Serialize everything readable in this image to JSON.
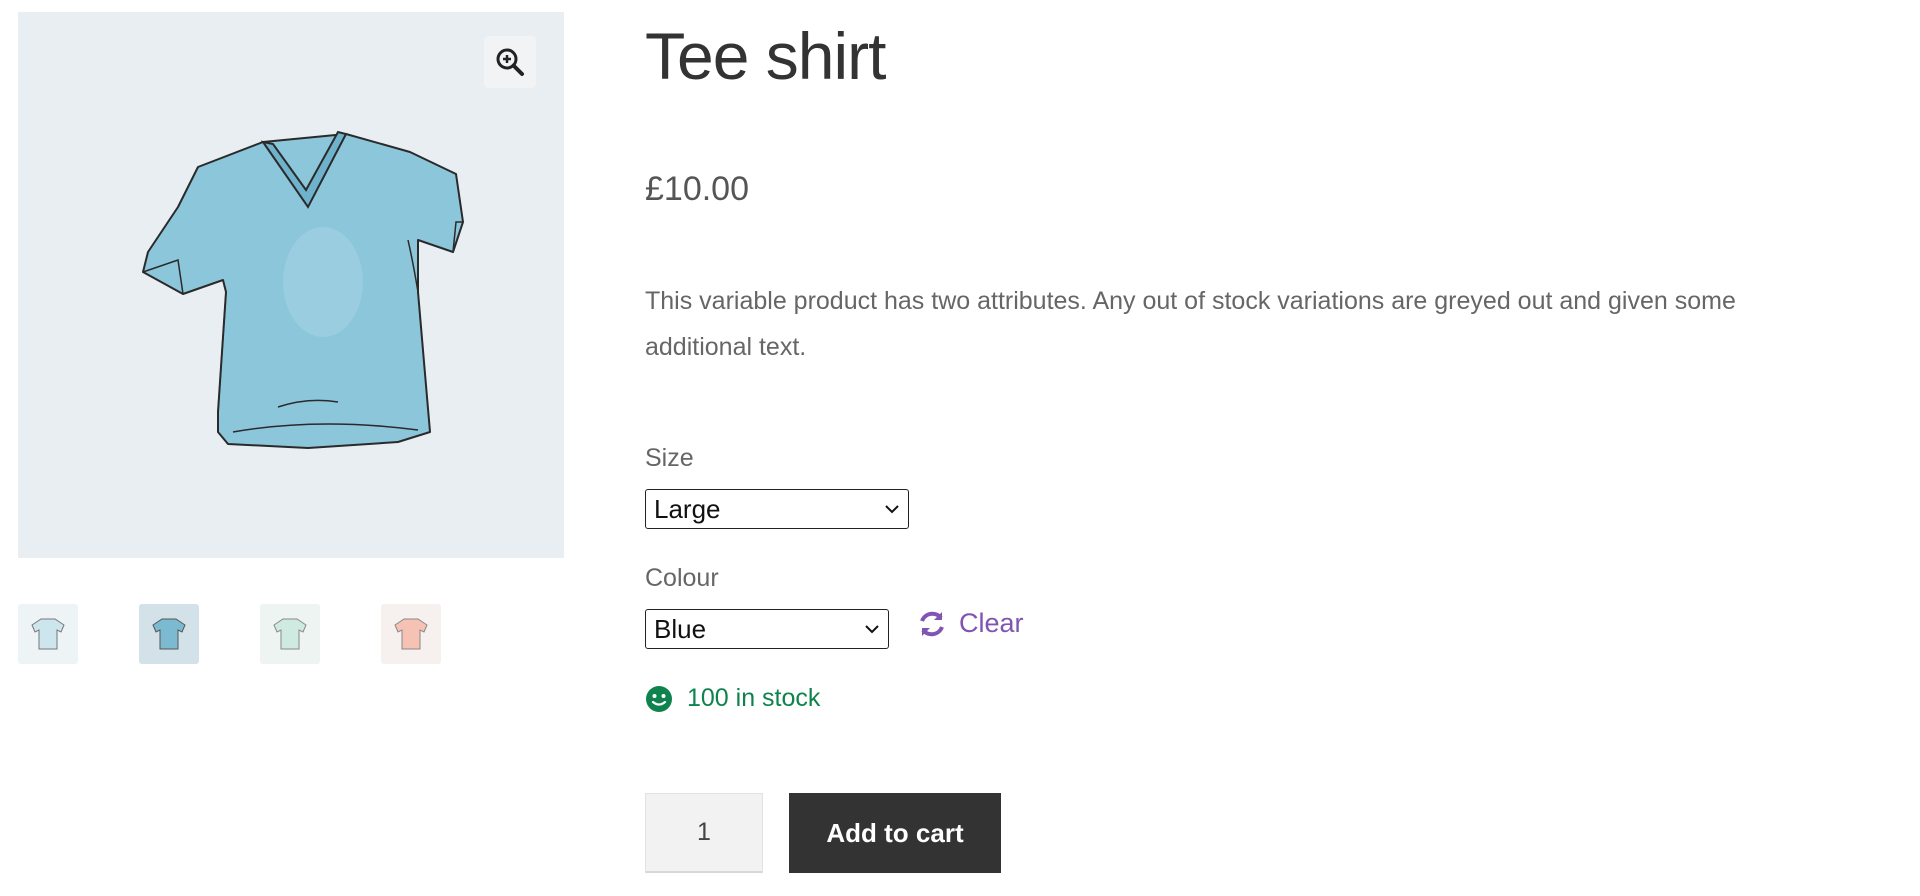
{
  "product": {
    "title": "Tee shirt",
    "price": "£10.00",
    "description": "This variable product has two attributes. Any out of stock variations are greyed out and given some additional text."
  },
  "gallery": {
    "zoom_icon": "zoom-in-icon",
    "main_image": "blue-tshirt",
    "thumbnails": [
      {
        "name": "light-blue-tshirt",
        "color": "#cde6ee"
      },
      {
        "name": "blue-tshirt",
        "color": "#7cbad1"
      },
      {
        "name": "mint-tshirt",
        "color": "#cfeae1"
      },
      {
        "name": "pink-tshirt",
        "color": "#f6c2b3"
      }
    ]
  },
  "variations": {
    "size": {
      "label": "Size",
      "selected": "Large"
    },
    "colour": {
      "label": "Colour",
      "selected": "Blue"
    },
    "clear_label": "Clear",
    "clear_icon": "refresh-icon"
  },
  "stock": {
    "text": "100 in stock",
    "icon": "smile-icon",
    "color": "#0f834d"
  },
  "cart": {
    "quantity": "1",
    "button_label": "Add to cart"
  },
  "colors": {
    "accent": "#7f54b3",
    "button_bg": "#333333",
    "image_bg": "#e8eef2"
  }
}
